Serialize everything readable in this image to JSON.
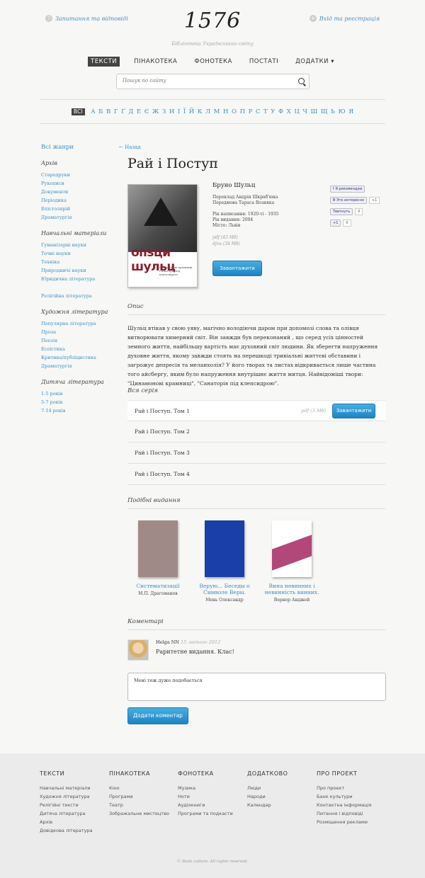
{
  "header": {
    "faq_link": "Запитання та відповіді",
    "login_link": "Вхід та реєстрація",
    "logo": "1576",
    "tagline": "Бібліотека Українського світу",
    "nav": [
      "ТЕКСТИ",
      "ПІНАКОТЕКА",
      "ФОНОТЕКА",
      "ПОСТАТІ",
      "ДОДАТКИ ▾"
    ],
    "search_placeholder": "Пошук по сайту"
  },
  "alphabet": {
    "all_label": "ВСІ",
    "letters": [
      "А",
      "Б",
      "В",
      "Г",
      "Ґ",
      "Д",
      "Е",
      "Є",
      "Ж",
      "З",
      "И",
      "І",
      "Ї",
      "Й",
      "К",
      "Л",
      "М",
      "Н",
      "О",
      "П",
      "Р",
      "С",
      "Т",
      "У",
      "Ф",
      "Х",
      "Ц",
      "Ч",
      "Ш",
      "Щ",
      "Ь",
      "Ю",
      "Я"
    ]
  },
  "sidebar": {
    "all_genres": "Всі жанри",
    "groups": [
      {
        "title": "Архів",
        "items": [
          "Стародруки",
          "Рукописи",
          "Документи",
          "Періодика",
          "Епістолярій",
          "Драматургія"
        ]
      },
      {
        "title": "Навчальні матеріали",
        "items": [
          "Гуманітарні науки",
          "Точні науки",
          "Техніка",
          "Природничі науки",
          "Юридична література"
        ]
      },
      {
        "title": "",
        "items": [
          "Релігійна література"
        ]
      },
      {
        "title": "Художня література",
        "items": [
          "Популярна література",
          "Проза",
          "Поезія",
          "Есеїстика",
          "Критика/публіцистика",
          "Драматургія"
        ]
      },
      {
        "title": "Дитяча література",
        "items": [
          "1-5 років",
          "5-7 років",
          "7-14 років"
        ]
      }
    ]
  },
  "book": {
    "back_label": "← Назад",
    "title": "Рай і Поступ",
    "cover_title": "опѕци шульц",
    "cover_sub": "Цинамонові крамниці · Санаторій під клепсидрою",
    "author": "Бруно Шульц",
    "translation": "Переклад Андрія Шкраб'юка",
    "foreword": "Передмова Тараса Возняка",
    "year_written": "Рік написання: 1920-ті - 1935",
    "year_published": "Рік видання: 2004",
    "city": "Місто: Львів",
    "formats": [
      "pdf (43 Мб)",
      "djvu (34 Мб)"
    ],
    "download_label": "Завантажити"
  },
  "social": {
    "fb": "f Я рекомендую",
    "vk": "В Это интересно",
    "vk_count": "+1",
    "tw": "Твитнуть",
    "tw_count": "0",
    "gp": "+1",
    "gp_count": "0"
  },
  "description": {
    "heading": "Опис",
    "text": "Шульц втікав у свою уяву, магічно володіючи даром при допомозі слова та олівця витворювати химерний світ. Він завжди був переконаний , що серед усіх цінностей земного життя, найбільшу вартість має духовний світ людини. Як зберегти напруження духовне життя, якому завжди стоять на перешкоді тривіальні життєві обставини і загрожує депресія та меланхолія? У його творах та листах відкривається лише частина того айсбергу, яким було напруження внутрішнє життя митця. Найвідоміші твори: \"Цинамонові крамниці\", \"Санаторія під клепсидрою\"."
  },
  "series": {
    "heading": "Вся серія",
    "items": [
      {
        "title": "Рай і Поступ. Том 1",
        "format": "pdf (3 Мб)",
        "button": "Завантажити"
      },
      {
        "title": "Рай і Поступ. Том 2"
      },
      {
        "title": "Рай і Поступ. Том 3"
      },
      {
        "title": "Рай і Поступ. Том 4"
      }
    ]
  },
  "similar": {
    "heading": "Подібні видання",
    "books": [
      {
        "title": "Систематизації",
        "author": "М.П. Драгоманов",
        "color": "#a08a88"
      },
      {
        "title": "Верую... Беседы о Символе Веры.",
        "author": "Мень Олександр",
        "color": "#1b3fa8"
      },
      {
        "title": "Вина невинних і невинність винних.",
        "author": "Вернер Анджей",
        "color": "#ffffff"
      }
    ]
  },
  "comments": {
    "heading": "Коментарі",
    "items": [
      {
        "name": "Helga NN",
        "date": "15 лютого 2012",
        "text": "Раритетне видання. Клас!"
      }
    ],
    "input_value": "Мені теж дуже подобається",
    "add_label": "Додати коментар"
  },
  "footer": {
    "columns": [
      {
        "title": "ТЕКСТИ",
        "items": [
          "Навчальні матеріали",
          "Художня література",
          "Релігійні тексти",
          "Дитяча література",
          "Архів",
          "Довідкова література"
        ]
      },
      {
        "title": "ПІНАКОТЕКА",
        "items": [
          "Кіно",
          "Програми",
          "Театр",
          "Зображальне мистецтво"
        ]
      },
      {
        "title": "ФОНОТЕКА",
        "items": [
          "Музика",
          "Ноти",
          "Аудіокниги",
          "Програми та подкасти"
        ]
      },
      {
        "title": "ДОДАТКОВО",
        "items": [
          "Люди",
          "Народи",
          "Календар"
        ]
      },
      {
        "title": "ПРО ПРОЕКТ",
        "items": [
          "Про проект",
          "Банк культури",
          "Контактна інформація",
          "Питання і відповіді",
          "Розміщення реклами"
        ]
      }
    ],
    "copyright": "© Bank culture. All rights reserved."
  }
}
